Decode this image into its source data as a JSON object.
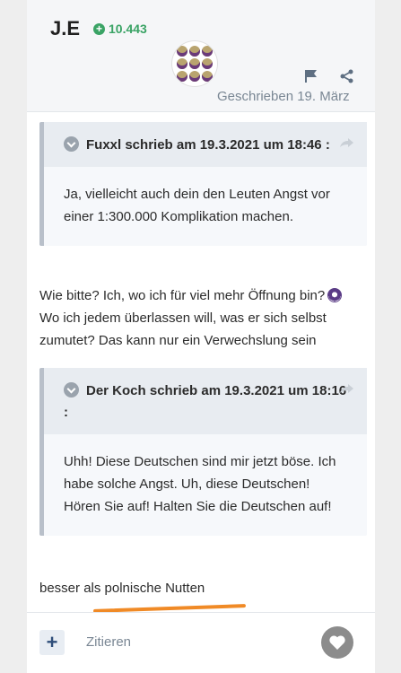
{
  "post": {
    "author": "J.E",
    "reputation": "10.443",
    "date": "Geschrieben 19. März"
  },
  "quotes": [
    {
      "header": "Fuxxl schrieb am 19.3.2021 um 18:46 :",
      "body": "Ja, vielleicht auch dein den Leuten Angst vor einer 1:300.000 Komplikation machen."
    },
    {
      "header": "Der Koch schrieb am 19.3.2021 um 18:16 :",
      "body": "Uhh! Diese Deutschen sind mir jetzt böse. Ich habe solche Angst. Uh, diese Deutschen! Hören Sie auf! Halten Sie die Deutschen auf!"
    }
  ],
  "reply_text": {
    "before_emoji": "Wie bitte? Ich, wo ich für viel mehr Öffnung bin?",
    "after_emoji": " Wo ich jedem überlassen will, was er sich selbst zumutet? Das kann nur ein Verwechslung sein"
  },
  "closing_text": "besser als polnische Nutten",
  "footer": {
    "add_label": "+",
    "cite_label": "Zitieren"
  },
  "colors": {
    "reputation": "#3aa365",
    "accent_underline": "#f08a26",
    "muted": "#7a8794"
  },
  "icons": [
    "plus-circle-icon",
    "flag-icon",
    "share-icon",
    "chevron-down-icon",
    "heart-icon"
  ]
}
